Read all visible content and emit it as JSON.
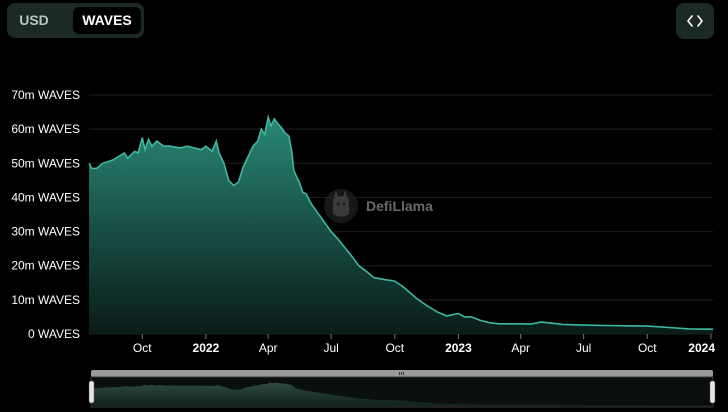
{
  "toggle": {
    "usd_label": "USD",
    "waves_label": "WAVES",
    "selected": "WAVES"
  },
  "embed": {
    "icon": "code-brackets-icon"
  },
  "watermark": {
    "text": "DefiLlama"
  },
  "colors": {
    "line": "#3fb8a2",
    "grid": "#1f1f1f",
    "background": "#000000",
    "panel": "#1c2a27"
  },
  "chart_data": {
    "type": "area",
    "title": "",
    "xlabel": "",
    "ylabel": "",
    "ylim": [
      0,
      70000000
    ],
    "y_ticks": [
      {
        "value": 0,
        "label": "0 WAVES"
      },
      {
        "value": 10000000,
        "label": "10m WAVES"
      },
      {
        "value": 20000000,
        "label": "20m WAVES"
      },
      {
        "value": 30000000,
        "label": "30m WAVES"
      },
      {
        "value": 40000000,
        "label": "40m WAVES"
      },
      {
        "value": 50000000,
        "label": "50m WAVES"
      },
      {
        "value": 60000000,
        "label": "60m WAVES"
      },
      {
        "value": 70000000,
        "label": "70m WAVES"
      }
    ],
    "x_ticks": [
      {
        "date": "2021-10-01",
        "label": "Oct",
        "bold": false
      },
      {
        "date": "2022-01-01",
        "label": "2022",
        "bold": true
      },
      {
        "date": "2022-04-01",
        "label": "Apr",
        "bold": false
      },
      {
        "date": "2022-07-01",
        "label": "Jul",
        "bold": false
      },
      {
        "date": "2022-10-01",
        "label": "Oct",
        "bold": false
      },
      {
        "date": "2023-01-01",
        "label": "2023",
        "bold": true
      },
      {
        "date": "2023-04-01",
        "label": "Apr",
        "bold": false
      },
      {
        "date": "2023-07-01",
        "label": "Jul",
        "bold": false
      },
      {
        "date": "2023-10-01",
        "label": "Oct",
        "bold": false
      },
      {
        "date": "2024-01-01",
        "label": "2024",
        "bold": true
      }
    ],
    "xlim": [
      "2021-07-16",
      "2024-01-04"
    ],
    "grid": true,
    "legend": "none",
    "series": [
      {
        "points": [
          [
            "2021-07-16",
            50000000
          ],
          [
            "2021-07-20",
            48500000
          ],
          [
            "2021-07-27",
            48500000
          ],
          [
            "2021-08-05",
            50000000
          ],
          [
            "2021-08-20",
            51000000
          ],
          [
            "2021-09-05",
            53000000
          ],
          [
            "2021-09-10",
            51500000
          ],
          [
            "2021-09-20",
            53500000
          ],
          [
            "2021-09-25",
            53000000
          ],
          [
            "2021-10-01",
            57500000
          ],
          [
            "2021-10-05",
            54000000
          ],
          [
            "2021-10-10",
            57000000
          ],
          [
            "2021-10-15",
            55000000
          ],
          [
            "2021-10-22",
            56500000
          ],
          [
            "2021-11-01",
            55000000
          ],
          [
            "2021-11-10",
            55000000
          ],
          [
            "2021-11-25",
            54500000
          ],
          [
            "2021-12-05",
            55000000
          ],
          [
            "2021-12-15",
            54500000
          ],
          [
            "2021-12-25",
            54000000
          ],
          [
            "2022-01-01",
            55000000
          ],
          [
            "2022-01-10",
            53500000
          ],
          [
            "2022-01-16",
            56500000
          ],
          [
            "2022-01-20",
            53000000
          ],
          [
            "2022-01-27",
            50000000
          ],
          [
            "2022-02-03",
            45000000
          ],
          [
            "2022-02-10",
            43500000
          ],
          [
            "2022-02-17",
            44500000
          ],
          [
            "2022-02-24",
            49000000
          ],
          [
            "2022-03-03",
            52000000
          ],
          [
            "2022-03-10",
            55000000
          ],
          [
            "2022-03-17",
            56500000
          ],
          [
            "2022-03-22",
            60000000
          ],
          [
            "2022-03-27",
            58500000
          ],
          [
            "2022-04-01",
            63500000
          ],
          [
            "2022-04-05",
            61000000
          ],
          [
            "2022-04-10",
            63000000
          ],
          [
            "2022-04-15",
            61500000
          ],
          [
            "2022-04-20",
            60500000
          ],
          [
            "2022-04-25",
            59000000
          ],
          [
            "2022-05-01",
            58000000
          ],
          [
            "2022-05-05",
            53500000
          ],
          [
            "2022-05-08",
            48000000
          ],
          [
            "2022-05-11",
            46500000
          ],
          [
            "2022-05-16",
            44500000
          ],
          [
            "2022-05-21",
            41500000
          ],
          [
            "2022-05-26",
            41000000
          ],
          [
            "2022-06-01",
            38500000
          ],
          [
            "2022-06-08",
            36500000
          ],
          [
            "2022-06-15",
            34500000
          ],
          [
            "2022-06-22",
            32500000
          ],
          [
            "2022-07-01",
            30000000
          ],
          [
            "2022-07-10",
            28000000
          ],
          [
            "2022-07-20",
            25500000
          ],
          [
            "2022-08-01",
            22500000
          ],
          [
            "2022-08-10",
            20000000
          ],
          [
            "2022-08-20",
            18500000
          ],
          [
            "2022-09-01",
            16500000
          ],
          [
            "2022-09-15",
            16000000
          ],
          [
            "2022-10-01",
            15500000
          ],
          [
            "2022-10-15",
            13500000
          ],
          [
            "2022-11-01",
            10500000
          ],
          [
            "2022-11-15",
            8500000
          ],
          [
            "2022-12-01",
            6500000
          ],
          [
            "2022-12-15",
            5300000
          ],
          [
            "2023-01-01",
            6000000
          ],
          [
            "2023-01-10",
            5000000
          ],
          [
            "2023-01-20",
            5000000
          ],
          [
            "2023-02-01",
            4000000
          ],
          [
            "2023-02-15",
            3300000
          ],
          [
            "2023-03-01",
            3000000
          ],
          [
            "2023-03-15",
            3000000
          ],
          [
            "2023-04-01",
            3000000
          ],
          [
            "2023-04-15",
            2900000
          ],
          [
            "2023-05-01",
            3500000
          ],
          [
            "2023-05-15",
            3200000
          ],
          [
            "2023-06-01",
            2800000
          ],
          [
            "2023-07-01",
            2600000
          ],
          [
            "2023-08-01",
            2500000
          ],
          [
            "2023-09-01",
            2400000
          ],
          [
            "2023-10-01",
            2300000
          ],
          [
            "2023-11-01",
            1900000
          ],
          [
            "2023-12-01",
            1500000
          ],
          [
            "2024-01-04",
            1400000
          ]
        ]
      }
    ]
  }
}
